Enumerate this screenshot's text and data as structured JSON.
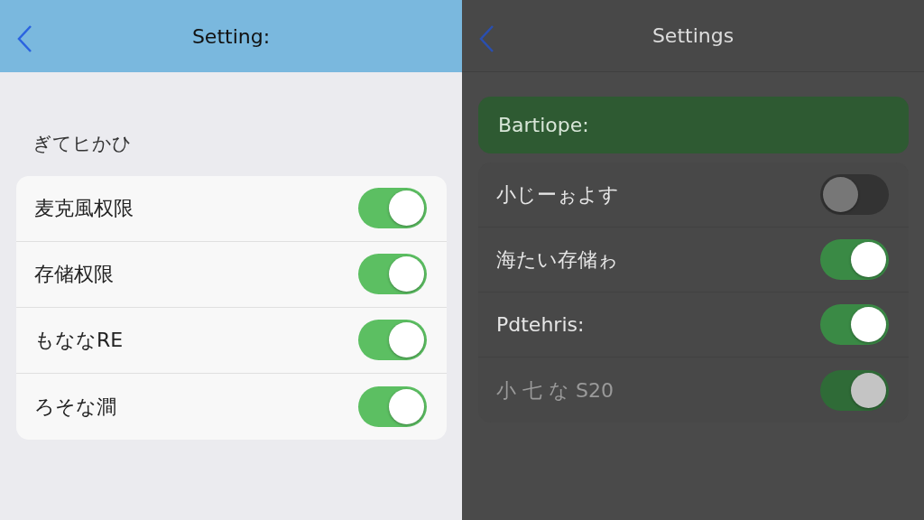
{
  "panels": [
    {
      "kind": "light",
      "title": "Setting:",
      "section": {
        "kind": "caption",
        "text": "ぎてヒかひ"
      },
      "rows": [
        {
          "label": "麦克風权限",
          "on": true,
          "disabled": false
        },
        {
          "label": "存储权限",
          "on": true,
          "disabled": false
        },
        {
          "label": "もななRE",
          "on": true,
          "disabled": false
        },
        {
          "label": "ろそな澗",
          "on": true,
          "disabled": false
        }
      ]
    },
    {
      "kind": "dark",
      "title": "Settings",
      "section": {
        "kind": "banner",
        "text": "Bartiope:"
      },
      "rows": [
        {
          "label": "小じーぉよす",
          "on": false,
          "disabled": false
        },
        {
          "label": "海たい存储ゎ",
          "on": true,
          "disabled": false
        },
        {
          "label": "Pdtehris:",
          "on": true,
          "disabled": false
        },
        {
          "label": "小 七 な S20",
          "on": true,
          "disabled": true
        }
      ]
    }
  ]
}
